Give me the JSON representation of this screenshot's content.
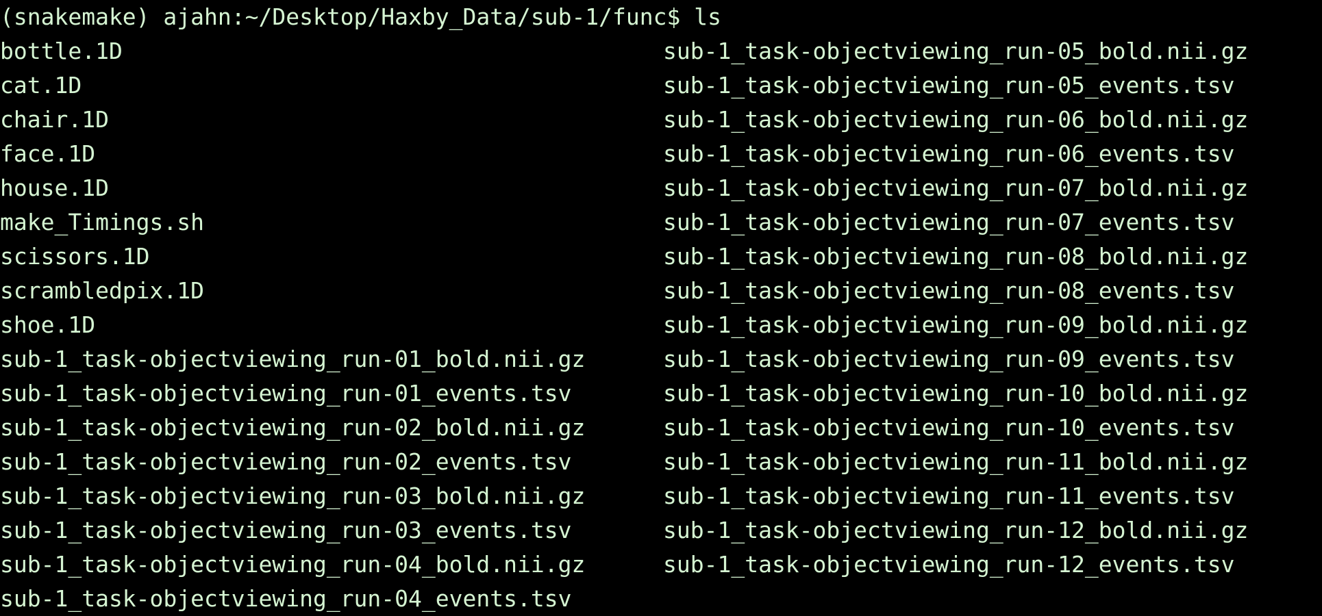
{
  "terminal": {
    "fg_color": "#d5f4d2",
    "bg_color": "#000000",
    "prompt": "(snakemake) ajahn:~/Desktop/Haxby_Data/sub-1/func$",
    "command": "ls",
    "left_column": [
      "bottle.1D",
      "cat.1D",
      "chair.1D",
      "face.1D",
      "house.1D",
      "make_Timings.sh",
      "scissors.1D",
      "scrambledpix.1D",
      "shoe.1D",
      "sub-1_task-objectviewing_run-01_bold.nii.gz",
      "sub-1_task-objectviewing_run-01_events.tsv",
      "sub-1_task-objectviewing_run-02_bold.nii.gz",
      "sub-1_task-objectviewing_run-02_events.tsv",
      "sub-1_task-objectviewing_run-03_bold.nii.gz",
      "sub-1_task-objectviewing_run-03_events.tsv",
      "sub-1_task-objectviewing_run-04_bold.nii.gz",
      "sub-1_task-objectviewing_run-04_events.tsv"
    ],
    "right_column": [
      "sub-1_task-objectviewing_run-05_bold.nii.gz",
      "sub-1_task-objectviewing_run-05_events.tsv",
      "sub-1_task-objectviewing_run-06_bold.nii.gz",
      "sub-1_task-objectviewing_run-06_events.tsv",
      "sub-1_task-objectviewing_run-07_bold.nii.gz",
      "sub-1_task-objectviewing_run-07_events.tsv",
      "sub-1_task-objectviewing_run-08_bold.nii.gz",
      "sub-1_task-objectviewing_run-08_events.tsv",
      "sub-1_task-objectviewing_run-09_bold.nii.gz",
      "sub-1_task-objectviewing_run-09_events.tsv",
      "sub-1_task-objectviewing_run-10_bold.nii.gz",
      "sub-1_task-objectviewing_run-10_events.tsv",
      "sub-1_task-objectviewing_run-11_bold.nii.gz",
      "sub-1_task-objectviewing_run-11_events.tsv",
      "sub-1_task-objectviewing_run-12_bold.nii.gz",
      "sub-1_task-objectviewing_run-12_events.tsv"
    ]
  }
}
